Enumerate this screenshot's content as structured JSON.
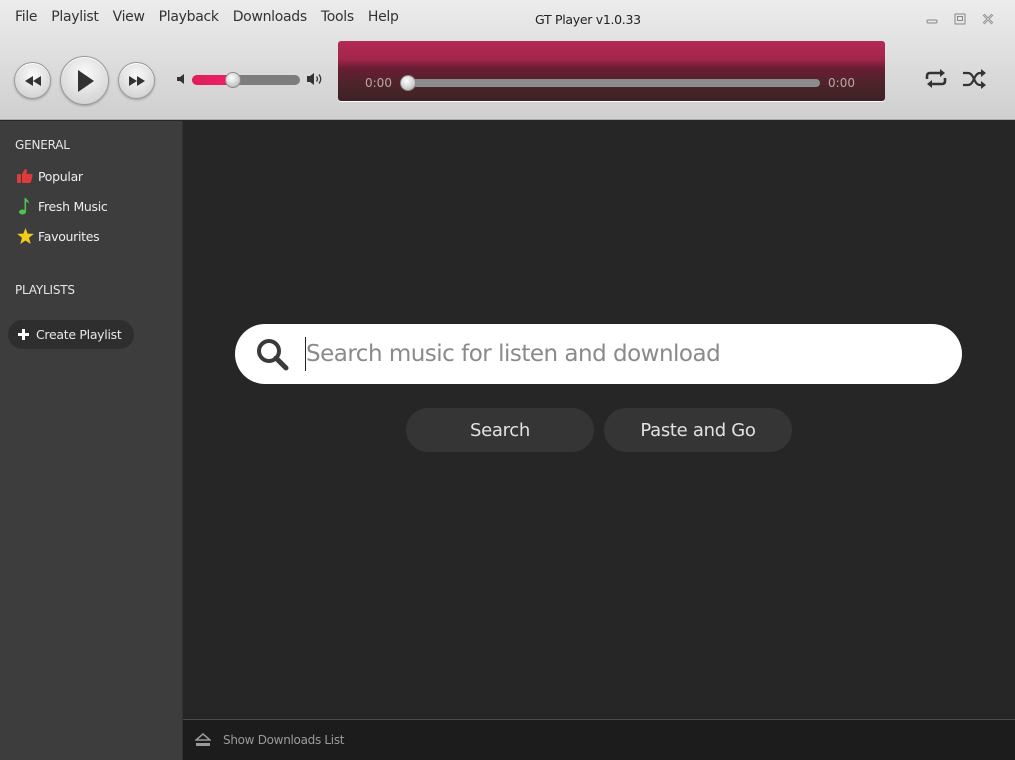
{
  "app": {
    "title": "GT Player v1.0.33"
  },
  "menu": [
    "File",
    "Playlist",
    "View",
    "Playback",
    "Downloads",
    "Tools",
    "Help"
  ],
  "window_controls": {
    "minimize": "minimize-icon",
    "maximize": "maximize-icon",
    "close": "close-icon"
  },
  "player": {
    "volume_percent": 38,
    "elapsed": "0:00",
    "duration": "0:00",
    "progress_percent": 0,
    "accent_color": "#e01e58"
  },
  "sidebar": {
    "general_title": "GENERAL",
    "items": [
      {
        "label": "Popular",
        "icon": "thumbs-up-icon",
        "color": "#e03a3a"
      },
      {
        "label": "Fresh Music",
        "icon": "music-note-icon",
        "color": "#4cc44c"
      },
      {
        "label": "Favourites",
        "icon": "star-icon",
        "color": "#f2cc1a"
      }
    ],
    "playlists_title": "PLAYLISTS",
    "create_playlist": "Create Playlist"
  },
  "search": {
    "placeholder": "Search music for listen and download",
    "value": "",
    "search_button": "Search",
    "paste_button": "Paste and Go"
  },
  "footer": {
    "downloads_label": "Show Downloads List"
  }
}
